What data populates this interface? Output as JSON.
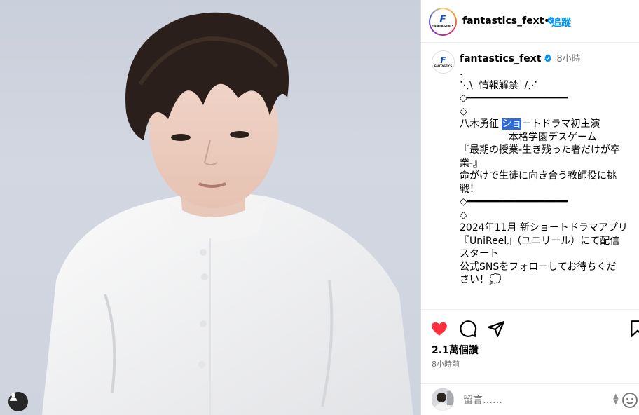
{
  "post": {
    "photo_alt_icon": "user-tag-icon",
    "header": {
      "username": "fantastics_fext",
      "separator": "•",
      "follow_label": "追蹤",
      "avatar_logo": "F",
      "avatar_text": "FANTASTICS"
    },
    "caption": {
      "username": "fantastics_fext",
      "time_ago": "8小時",
      "lines": [
        ".",
        "⋱\\  情報解禁  /⋰",
        "",
        "◇━━━━━━━━━━━━━━━━━",
        "◇",
        "八木勇征 ",
        "　　　　　本格学園デスゲーム",
        "『最期の授業-生き残った者だけが卒",
        "業-』",
        "命がけで生徒に向き合う教師役に挑",
        "戦！",
        "◇━━━━━━━━━━━━━━━━━",
        "◇",
        "",
        "2024年11月 新ショートドラマアプリ",
        "『UniReel』（ユニリール）にて配信",
        "スタート",
        "",
        "公式SNSをフォローしてお待ちくだ",
        "さい！💭"
      ],
      "selected_text": "ショ",
      "line6_rest": "ートドラマ初主演"
    },
    "likes": "2.1萬個讚",
    "posted_ago": "8小時前",
    "comment": {
      "placeholder": "留言……"
    },
    "colors": {
      "like_red": "#ff3040",
      "link_blue": "#0095f6",
      "verified_blue": "#0095f6",
      "selection": "#2f6ad8"
    },
    "icons": [
      "heart-icon",
      "comment-icon",
      "share-icon",
      "bookmark-icon",
      "emoji-icon",
      "verified-icon"
    ]
  }
}
